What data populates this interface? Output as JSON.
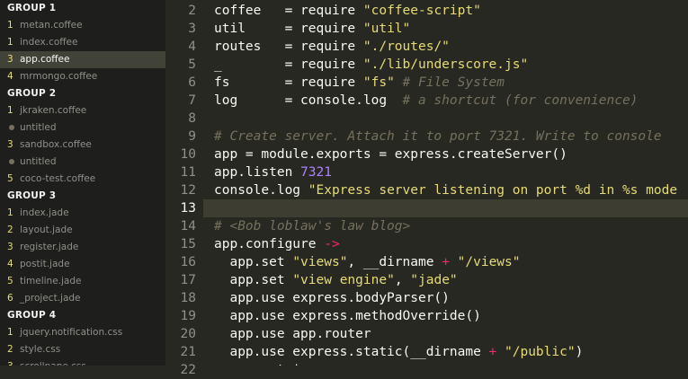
{
  "colors": {
    "default": "#f8f8f2",
    "string": "#e6db74",
    "comment": "#75715e",
    "number": "#ae81ff",
    "operator": "#f92672",
    "gutter": "#8f908a",
    "background": "#272822",
    "sidebar_bg": "#1e1f1c",
    "selected_file_bg": "#414339",
    "active_line_bg": "#3e3d32"
  },
  "sidebar": {
    "groups": [
      {
        "title": "GROUP 1",
        "items": [
          {
            "marker": "1",
            "label": "metan.coffee"
          },
          {
            "marker": "1",
            "label": "index.coffee"
          },
          {
            "marker": "3",
            "label": "app.coffee",
            "selected": true
          },
          {
            "marker": "4",
            "label": "mrmongo.coffee"
          }
        ]
      },
      {
        "title": "GROUP 2",
        "items": [
          {
            "marker": "1",
            "label": "jkraken.coffee"
          },
          {
            "marker": "dot",
            "label": "untitled"
          },
          {
            "marker": "3",
            "label": "sandbox.coffee"
          },
          {
            "marker": "dot",
            "label": "untitled"
          },
          {
            "marker": "5",
            "label": "coco-test.coffee"
          }
        ]
      },
      {
        "title": "GROUP 3",
        "items": [
          {
            "marker": "1",
            "label": "index.jade"
          },
          {
            "marker": "2",
            "label": "layout.jade"
          },
          {
            "marker": "3",
            "label": "register.jade"
          },
          {
            "marker": "4",
            "label": "postit.jade"
          },
          {
            "marker": "5",
            "label": "timeline.jade"
          },
          {
            "marker": "6",
            "label": "_project.jade"
          }
        ]
      },
      {
        "title": "GROUP 4",
        "items": [
          {
            "marker": "1",
            "label": "jquery.notification.css"
          },
          {
            "marker": "2",
            "label": "style.css"
          },
          {
            "marker": "3",
            "label": "scrollpane.css"
          }
        ]
      }
    ]
  },
  "editor": {
    "lines": [
      {
        "num": "2",
        "tokens": [
          {
            "t": "coffee   = require "
          },
          {
            "t": "\"coffee-script\"",
            "c": "string"
          }
        ]
      },
      {
        "num": "3",
        "tokens": [
          {
            "t": "util     = require "
          },
          {
            "t": "\"util\"",
            "c": "string"
          }
        ]
      },
      {
        "num": "4",
        "tokens": [
          {
            "t": "routes   = require "
          },
          {
            "t": "\"./routes/\"",
            "c": "string"
          }
        ]
      },
      {
        "num": "5",
        "tokens": [
          {
            "t": "_        = require "
          },
          {
            "t": "\"./lib/underscore.js\"",
            "c": "string"
          }
        ]
      },
      {
        "num": "6",
        "tokens": [
          {
            "t": "fs       = require "
          },
          {
            "t": "\"fs\"",
            "c": "string"
          },
          {
            "t": " # File System",
            "c": "comment"
          }
        ]
      },
      {
        "num": "7",
        "tokens": [
          {
            "t": "log      = console.log  "
          },
          {
            "t": "# a shortcut (for convenience)",
            "c": "comment"
          }
        ]
      },
      {
        "num": "8",
        "tokens": []
      },
      {
        "num": "9",
        "tokens": [
          {
            "t": "# Create server. Attach it to port 7321. Write to console",
            "c": "comment"
          }
        ]
      },
      {
        "num": "10",
        "tokens": [
          {
            "t": "app = module.exports = express.createServer()"
          }
        ]
      },
      {
        "num": "11",
        "tokens": [
          {
            "t": "app.listen "
          },
          {
            "t": "7321",
            "c": "number"
          }
        ]
      },
      {
        "num": "12",
        "tokens": [
          {
            "t": "console.log "
          },
          {
            "t": "\"Express server listening on port %d in %s mode",
            "c": "string"
          }
        ]
      },
      {
        "num": "13",
        "tokens": [],
        "active": true
      },
      {
        "num": "14",
        "tokens": [
          {
            "t": "# <Bob loblaw's law blog>",
            "c": "comment"
          }
        ]
      },
      {
        "num": "15",
        "tokens": [
          {
            "t": "app.configure "
          },
          {
            "t": "->",
            "c": "operator"
          }
        ]
      },
      {
        "num": "16",
        "tokens": [
          {
            "t": "  app.set "
          },
          {
            "t": "\"views\"",
            "c": "string"
          },
          {
            "t": ", __dirname "
          },
          {
            "t": "+",
            "c": "operator"
          },
          {
            "t": " "
          },
          {
            "t": "\"/views\"",
            "c": "string"
          }
        ]
      },
      {
        "num": "17",
        "tokens": [
          {
            "t": "  app.set "
          },
          {
            "t": "\"view engine\"",
            "c": "string"
          },
          {
            "t": ", "
          },
          {
            "t": "\"jade\"",
            "c": "string"
          }
        ]
      },
      {
        "num": "18",
        "tokens": [
          {
            "t": "  app.use express.bodyParser()"
          }
        ]
      },
      {
        "num": "19",
        "tokens": [
          {
            "t": "  app.use express.methodOverride()"
          }
        ]
      },
      {
        "num": "20",
        "tokens": [
          {
            "t": "  app.use app.router"
          }
        ]
      },
      {
        "num": "21",
        "tokens": [
          {
            "t": "  app.use express.static(__dirname "
          },
          {
            "t": "+",
            "c": "operator"
          },
          {
            "t": " "
          },
          {
            "t": "\"/public\"",
            "c": "string"
          },
          {
            "t": ")"
          }
        ]
      },
      {
        "num": "22",
        "tokens": [
          {
            "t": "  app.set 'p"
          }
        ]
      }
    ]
  }
}
